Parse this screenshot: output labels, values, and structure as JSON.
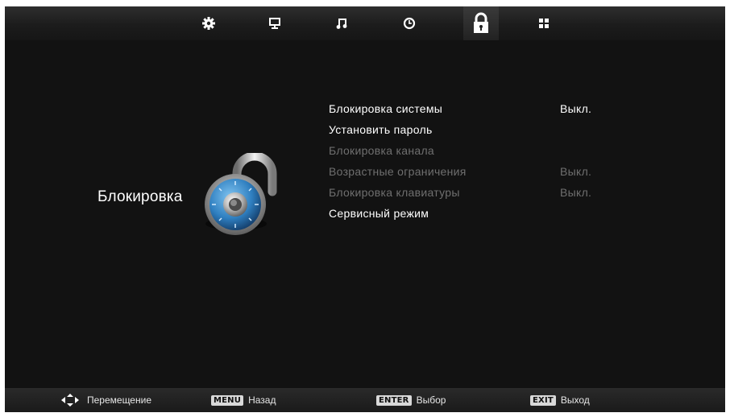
{
  "tabs": [
    {
      "icon": "settings-gear-icon",
      "active": false
    },
    {
      "icon": "display-icon",
      "active": false
    },
    {
      "icon": "music-note-icon",
      "active": false
    },
    {
      "icon": "clock-icon",
      "active": false
    },
    {
      "icon": "lock-icon",
      "active": true
    },
    {
      "icon": "apps-grid-icon",
      "active": false
    }
  ],
  "section": {
    "title": "Блокировка",
    "icon": "combination-padlock-icon"
  },
  "menu": [
    {
      "label": "Блокировка системы",
      "value": "Выкл.",
      "enabled": true
    },
    {
      "label": "Установить пароль",
      "value": "",
      "enabled": true
    },
    {
      "label": "Блокировка канала",
      "value": "",
      "enabled": false
    },
    {
      "label": "Возрастные ограничения",
      "value": "Выкл.",
      "enabled": false
    },
    {
      "label": "Блокировка клавиатуры",
      "value": "Выкл.",
      "enabled": false
    },
    {
      "label": "Сервисный режим",
      "value": "",
      "enabled": true
    }
  ],
  "hints": [
    {
      "icon": "nav-arrows-icon",
      "key": "",
      "label": "Перемещение"
    },
    {
      "icon": "",
      "key": "MENU",
      "label": "Назад"
    },
    {
      "icon": "",
      "key": "ENTER",
      "label": "Выбор"
    },
    {
      "icon": "",
      "key": "EXIT",
      "label": "Выход"
    }
  ],
  "colors": {
    "background": "#121212",
    "text": "#ffffff",
    "disabled_text": "#6f6f6f",
    "lock_dial": "#2f7fc0"
  }
}
